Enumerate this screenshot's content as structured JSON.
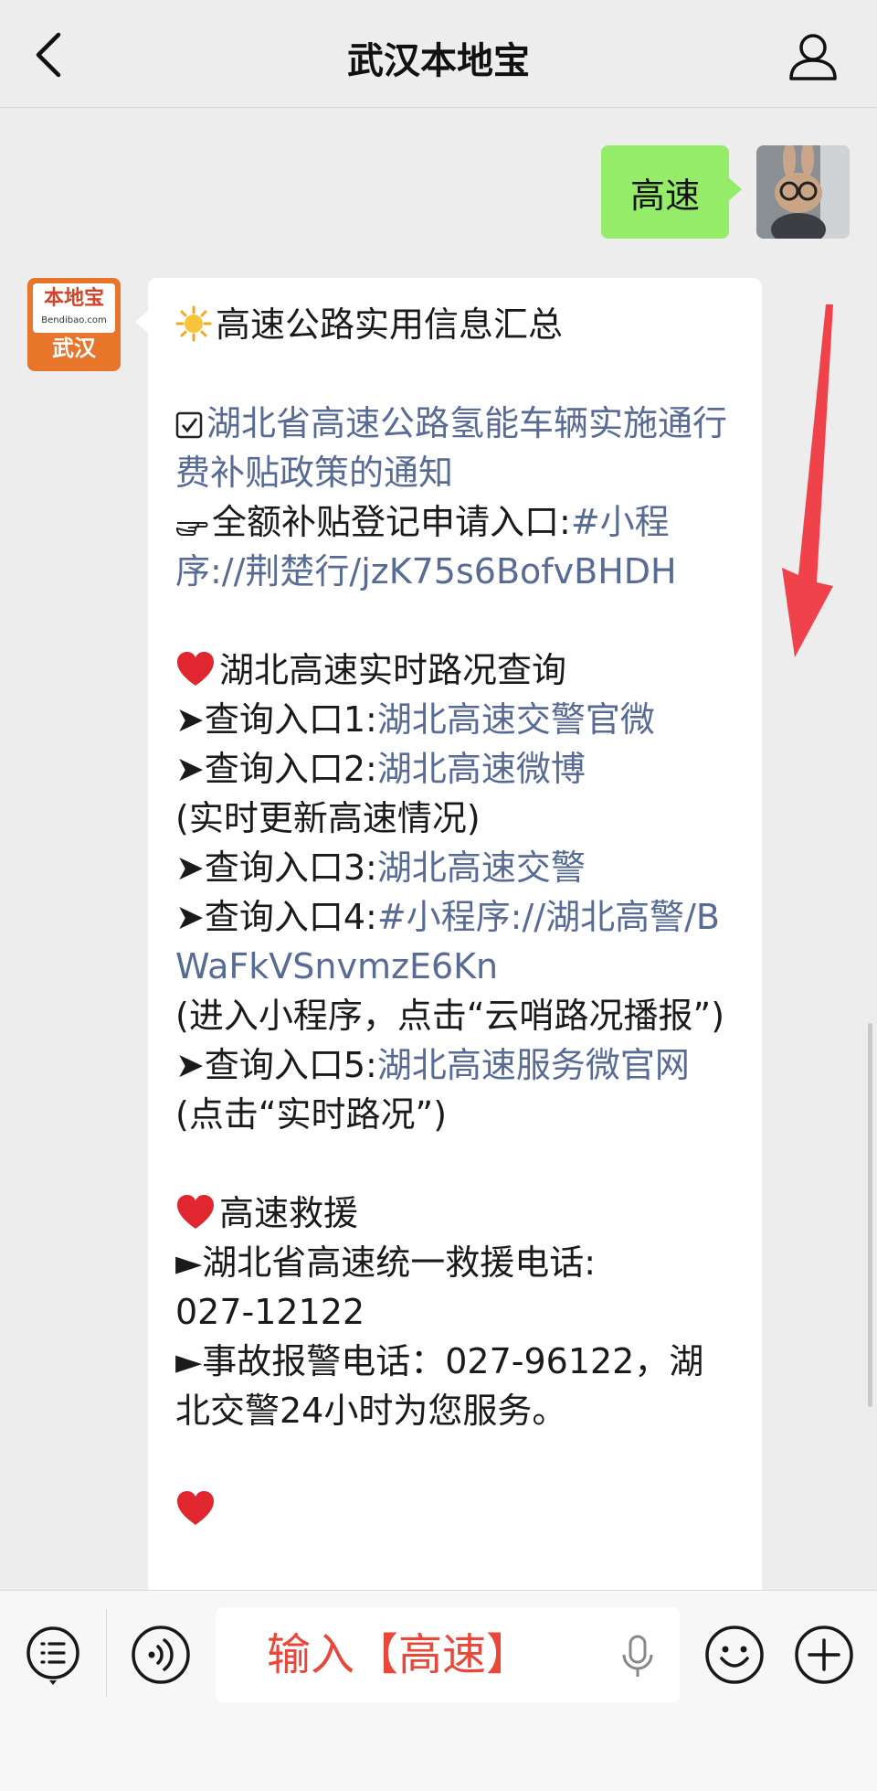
{
  "header": {
    "title": "武汉本地宝"
  },
  "chat": {
    "outgoing": {
      "text": "高速"
    },
    "brand_avatar": {
      "logo_main": "本地宝",
      "logo_sub": "Bendibao.com",
      "city": "武汉"
    },
    "message": {
      "title": "高速公路实用信息汇总",
      "policy_title": "湖北省高速公路氢能车辆实施通行费补贴政策的通知",
      "subsidy_prefix": "全额补贴登记申请入口:",
      "subsidy_link": "#小程序://荆楚行/jzK75s6BofvBHDH",
      "traffic_title": "湖北高速实时路况查询",
      "entry1_prefix": "➤查询入口1:",
      "entry1_link": "湖北高速交警官微",
      "entry2_prefix": "➤查询入口2:",
      "entry2_link": "湖北高速微博",
      "entry2_note": "(实时更新高速情况)",
      "entry3_prefix": "➤查询入口3:",
      "entry3_link": "湖北高速交警",
      "entry4_prefix": "➤查询入口4:",
      "entry4_link": "#小程序://湖北高警/BWaFkVSnvmzE6Kn",
      "entry4_note": "(进入小程序，点击“云哨路况播报”)",
      "entry5_prefix": "➤查询入口5:",
      "entry5_link": "湖北高速服务微官网",
      "entry5_note": "(点击“实时路况”)",
      "rescue_title": "高速救援",
      "rescue_line1": "►湖北省高速统一救援电话:",
      "rescue_phone": "027-12122",
      "accident_line": "►事故报警电话：027-96122，湖北交警24小时为您服务。"
    }
  },
  "input": {
    "placeholder": "输入【高速】"
  },
  "icons": {
    "back": "chevron-left-icon",
    "profile": "person-icon",
    "menu": "list-menu-icon",
    "voice": "voice-icon",
    "mic": "microphone-icon",
    "emoji": "smiley-icon",
    "plus": "plus-icon",
    "sun": "sun-emoji",
    "heart": "heart-emoji",
    "checkbox": "checkbox-icon",
    "pointing_hand": "pointing-hand-icon"
  },
  "colors": {
    "background": "#ededed",
    "outgoing_bubble": "#95ec69",
    "link": "#576b95",
    "annotation_arrow": "#f0424a",
    "input_hint": "#e8473a"
  }
}
